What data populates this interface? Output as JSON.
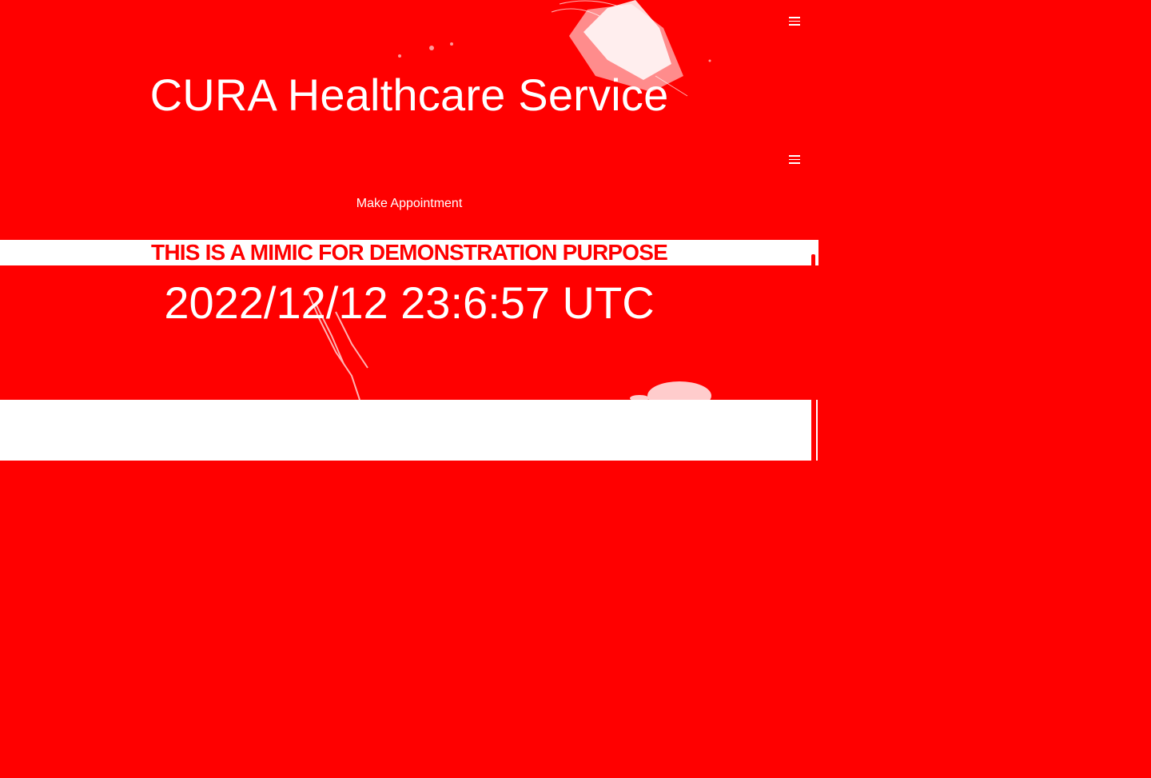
{
  "header": {
    "menu_icon": "hamburger-icon",
    "title": "CURA Healthcare Service"
  },
  "nav": {
    "menu_icon": "hamburger-icon"
  },
  "actions": {
    "make_appointment": "Make Appointment"
  },
  "banner": {
    "text": "THIS IS A MIMIC FOR DEMONSTRATION PURPOSE"
  },
  "clock": {
    "datetime": "2022/12/12 23:6:57 UTC"
  },
  "colors": {
    "background": "#ff0000",
    "foreground": "#ffffff"
  }
}
